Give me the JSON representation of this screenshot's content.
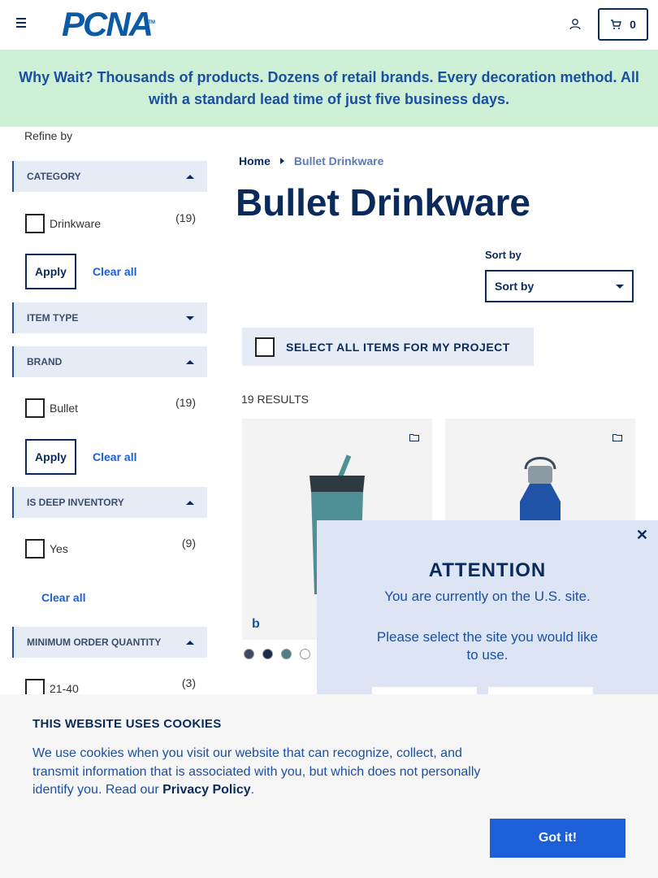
{
  "header": {
    "logo_text": "PCNA",
    "logo_tm": "TM",
    "cart_count": "0",
    "icons": [
      "menu-icon",
      "user-icon",
      "cart-icon"
    ]
  },
  "banner": {
    "text": "Why Wait? Thousands of products. Dozens of retail brands. Every decoration method. All with a standard lead time of just five business days."
  },
  "sidebar": {
    "refine_label": "Refine by",
    "facets": [
      {
        "title": "CATEGORY",
        "expanded": true,
        "options": [
          {
            "label": "Drinkware",
            "count": "(19)"
          }
        ],
        "apply_label": "Apply",
        "clear_label": "Clear all"
      },
      {
        "title": "ITEM TYPE",
        "expanded": false
      },
      {
        "title": "BRAND",
        "expanded": true,
        "options": [
          {
            "label": "Bullet",
            "count": "(19)"
          }
        ],
        "apply_label": "Apply",
        "clear_label": "Clear all"
      },
      {
        "title": "IS DEEP INVENTORY",
        "expanded": true,
        "options": [
          {
            "label": "Yes",
            "count": "(9)"
          }
        ],
        "clear_label": "Clear all"
      },
      {
        "title": "MINIMUM ORDER QUANTITY",
        "expanded": true,
        "options": [
          {
            "label": "21-40",
            "count": "(3)"
          }
        ]
      }
    ]
  },
  "main": {
    "breadcrumb": {
      "home": "Home",
      "current": "Bullet Drinkware"
    },
    "title": "Bullet Drinkware",
    "sort": {
      "label": "Sort by",
      "selected": "Sort by"
    },
    "select_all_label": "SELECT ALL ITEMS FOR MY PROJECT",
    "results_label": "19 RESULTS",
    "products": [
      {
        "image": "teal-tumbler-with-straw",
        "brand_mark": "b",
        "swatches": [
          "#3c4a63",
          "#1d2a48",
          "#4f7f86",
          "#ffffff"
        ]
      },
      {
        "image": "blue-steel-bottle"
      }
    ]
  },
  "modal": {
    "close": "✕",
    "title": "ATTENTION",
    "message1": "You are currently on the U.S. site.",
    "message2": "Please select the site you would like to use."
  },
  "cookie": {
    "title": "THIS WEBSITE USES COOKIES",
    "text_before": "We use cookies when you visit our website that can recognize, collect, and transmit information that is associated with you, but which does not personally identify you. Read our ",
    "link": "Privacy Policy",
    "text_after": ".",
    "button": "Got it!"
  },
  "colors": {
    "navy": "#0a2a5c",
    "blue": "#1c4fa0",
    "link": "#1c5fd6",
    "banner_bg": "#cdf0d6",
    "facet_bg": "#e6ecf6"
  }
}
